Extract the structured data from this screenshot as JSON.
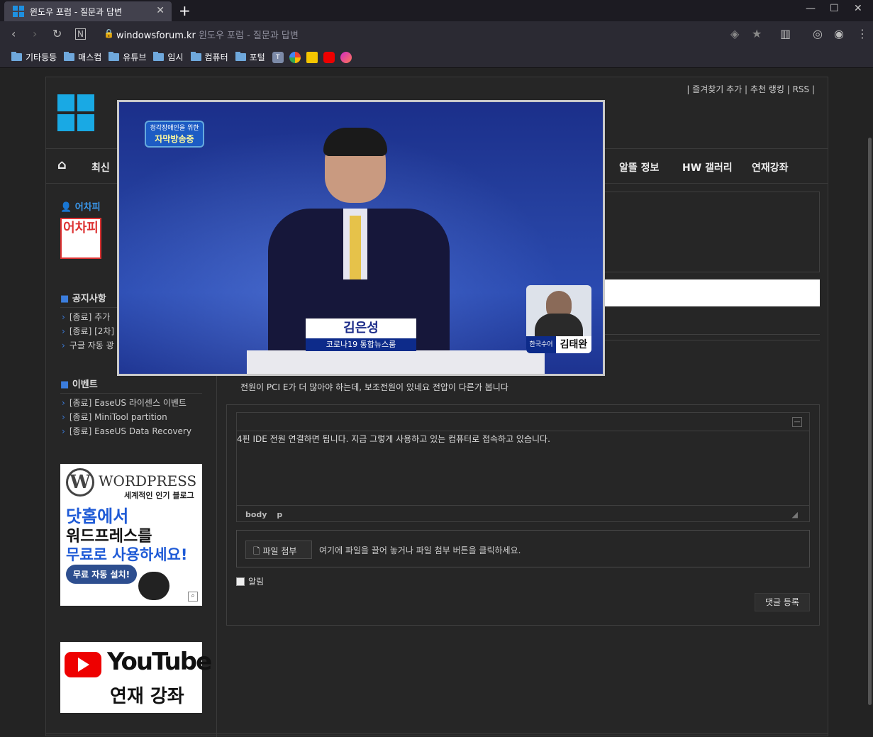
{
  "browser": {
    "tab_title": "윈도우 포럼 - 질문과 답변",
    "url_domain": "windowsforum.kr",
    "url_page_title": "윈도우 포럼 - 질문과 답변",
    "bookmarks": [
      "기타등등",
      "매스컴",
      "유튜브",
      "임시",
      "컴퓨터",
      "포털"
    ],
    "bookmark_icons": [
      "T"
    ]
  },
  "site": {
    "top_links": [
      "즐겨찾기 추가",
      "추천 랭킹",
      "RSS"
    ],
    "nav": [
      "최신",
      "알뜰 정보",
      "HW 갤러리",
      "연재강좌"
    ],
    "user_name": "어차피",
    "avatar_text": "어차피"
  },
  "sidebar": {
    "notice_title": "공지사항",
    "notices": [
      "[종료] 추가",
      "[종료] [2차]",
      "구글 자동 광"
    ],
    "event_title": "이벤트",
    "events": [
      "[종료] EaseUS 라이센스 이벤트",
      "[종료] MiniTool partition",
      "[종료] EaseUS Data Recovery"
    ],
    "wp_ad": {
      "brand": "WORDPRESS",
      "tagline": "세계적인 인기 블로그",
      "line1": "닷홈에서",
      "line2": "워드프레스를",
      "line3": "무료로 사용하세요!",
      "button": "무료 자동 설치!"
    },
    "yt_ad": {
      "brand": "YouTube",
      "subtitle": "연재 강좌"
    }
  },
  "content": {
    "comment_text": "전원이 PCI E가 더 많아야 하는데, 보조전원이 있네요 전압이 다른가 봅니다",
    "editor_text": "4핀 IDE 전원 연결하면 됩니다. 지금 그렇게 사용하고 있는 컴퓨터로 접속하고 있습니다.",
    "editor_path": [
      "body",
      "p"
    ],
    "file_button": "파일 첨부",
    "file_hint": "여기에 파일을 끌어 놓거나 파일 첨부 버튼을 클릭하세요.",
    "notify_label": "알림",
    "submit_label": "댓글 등록"
  },
  "video": {
    "badge_line1": "청각장애인을 위한",
    "badge_line2": "자막방송중",
    "anchor_name": "김은성",
    "show_name": "코로나19 통합뉴스룸",
    "sign_label": "한국수어",
    "sign_name": "김태완"
  },
  "colors": {
    "accent": "#3b7ddd",
    "page_bg": "#232323"
  }
}
